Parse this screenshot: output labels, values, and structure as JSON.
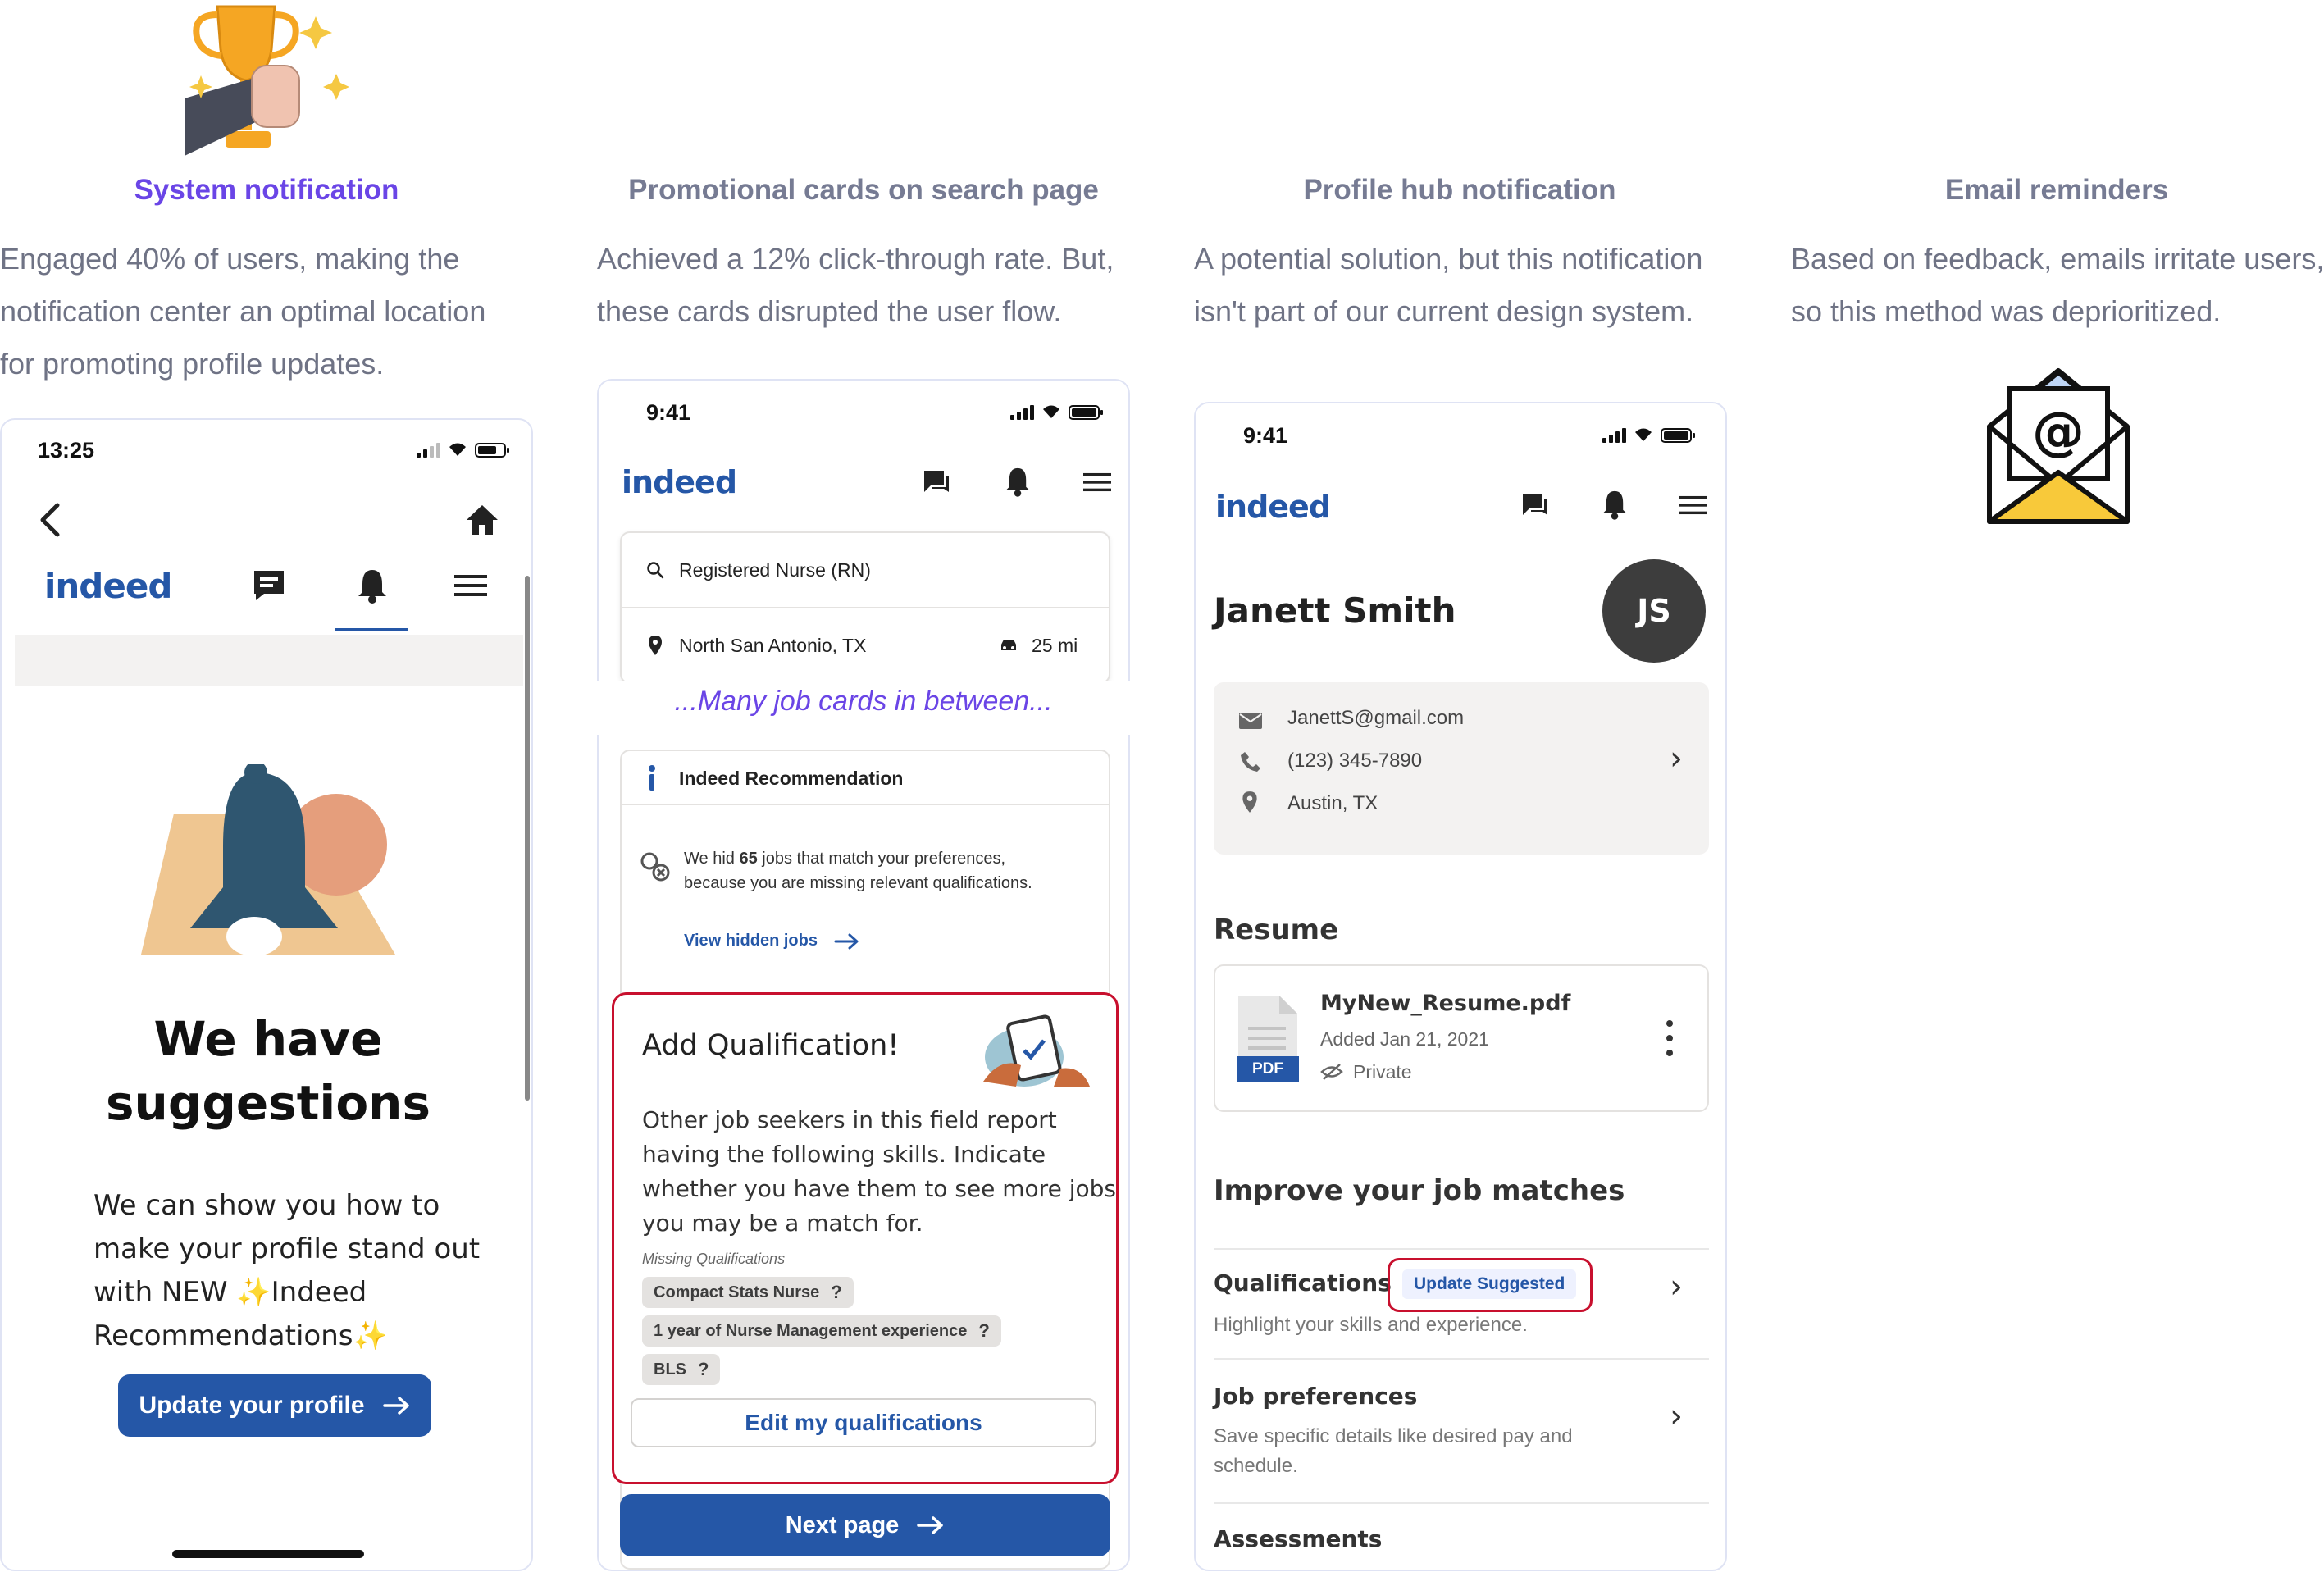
{
  "columns": [
    {
      "title": "System notification",
      "desc_lines": [
        "Engaged 40% of users, making the",
        "notification center an optimal location",
        "for promoting profile updates."
      ]
    },
    {
      "title": "Promotional cards on search page",
      "desc_lines": [
        "Achieved a 12% click-through rate. But,",
        "these cards disrupted the user flow."
      ]
    },
    {
      "title": "Profile hub notification",
      "desc_lines": [
        "A potential solution, but this notification",
        "isn't part of our current design system."
      ]
    },
    {
      "title": "Email reminders",
      "desc_lines": [
        "Based on feedback, emails irritate users,",
        "so this method was deprioritized."
      ]
    }
  ],
  "phone1": {
    "time": "13:25",
    "logo": "indeed",
    "headline_line1": "We have",
    "headline_line2": "suggestions",
    "body_lines": [
      "We can show you how to",
      "make your profile stand out",
      "with NEW ✨Indeed",
      "Recommendations✨"
    ],
    "cta": "Update your profile",
    "icons": [
      "back-icon",
      "home-icon",
      "message-icon",
      "bell-icon",
      "menu-icon"
    ]
  },
  "phone2": {
    "time": "9:41",
    "logo": "indeed",
    "search_query": "Registered Nurse (RN)",
    "location": "North San Antonio, TX",
    "distance": "25 mi",
    "between_note": "...Many job cards in between...",
    "rec_title": "Indeed Recommendation",
    "rec_text_prefix": "We hid ",
    "rec_count": "65",
    "rec_text_suffix": " jobs that match your preferences,",
    "rec_text_line2": "because you are missing relevant qualifications.",
    "view_hidden": "View hidden jobs",
    "add_title": "Add Qualification!",
    "add_body_lines": [
      "Other job seekers in this field report",
      "having the following skills. Indicate",
      "whether you have them to see more jobs",
      "you may be a match for."
    ],
    "missing_label": "Missing Qualifications",
    "chips": [
      "Compact Stats Nurse",
      "1 year of Nurse Management experience",
      "BLS"
    ],
    "chip_help": "?",
    "edit_button": "Edit my qualifications",
    "next_page": "Next page",
    "highlight_color": "#c8102e"
  },
  "phone3": {
    "time": "9:41",
    "logo": "indeed",
    "name": "Janett Smith",
    "initials": "JS",
    "email": "JanettS@gmail.com",
    "phone": "(123) 345-7890",
    "location": "Austin, TX",
    "resume_heading": "Resume",
    "resume_file": "MyNew_Resume.pdf",
    "resume_added": "Added Jan 21, 2021",
    "resume_privacy": "Private",
    "pdf_badge": "PDF",
    "improve_heading": "Improve your job matches",
    "items": [
      {
        "title": "Qualifications",
        "desc": "Highlight your skills and experience.",
        "badge": "Update Suggested"
      },
      {
        "title": "Job preferences",
        "desc_line1": "Save specific details like desired pay and",
        "desc_line2": "schedule."
      },
      {
        "title": "Assessments"
      }
    ]
  },
  "colors": {
    "brand_blue": "#2557a7",
    "accent_purple": "#6a45e6",
    "highlight_red": "#c8102e",
    "muted_text": "#6f7385"
  }
}
